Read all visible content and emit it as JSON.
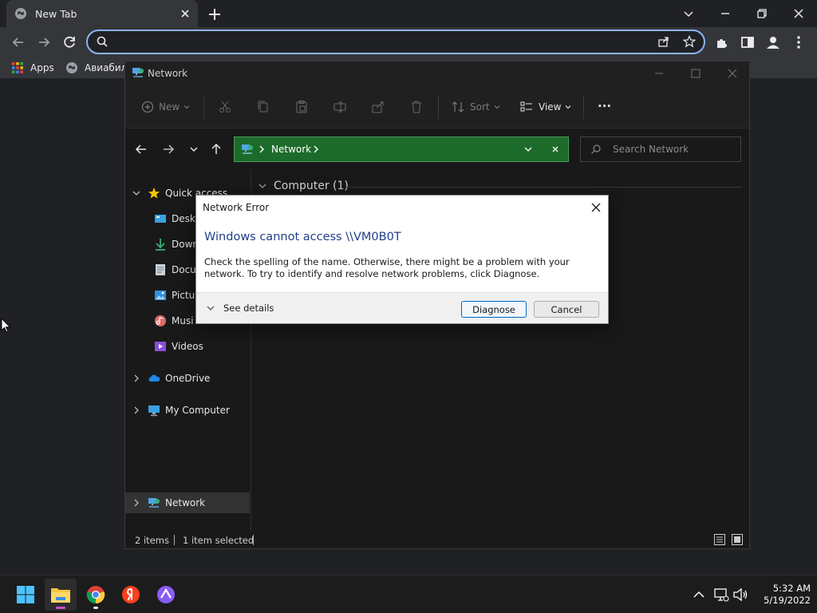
{
  "browser": {
    "tab_title": "New Tab",
    "omnibox_placeholder": "",
    "bookmarks": [
      {
        "label": "Apps",
        "icon": "apps-grid-icon"
      },
      {
        "label": "Авиабиле",
        "icon": "globe-icon"
      }
    ]
  },
  "explorer": {
    "window_title": "Network",
    "commands": {
      "new": "New",
      "sort": "Sort",
      "view": "View",
      "more": "..."
    },
    "address_crumb": "Network",
    "search_placeholder": "Search Network",
    "nav": {
      "quick_access": "Quick access",
      "desktop": "Deskt",
      "downloads": "Down",
      "documents": "Docu",
      "pictures": "Pictur",
      "music": "Musi",
      "videos": "Videos",
      "onedrive": "OneDrive",
      "my_computer": "My Computer",
      "network": "Network"
    },
    "group_header": "Computer (1)",
    "status": {
      "items": "2 items",
      "selected": "1 item selected"
    }
  },
  "dialog": {
    "title": "Network Error",
    "main_instruction": "Windows cannot access \\\\VM0B0T",
    "body": "Check the spelling of the name. Otherwise, there might be a problem with your network. To try to identify and resolve network problems, click Diagnose.",
    "see_details": "See details",
    "diagnose": "Diagnose",
    "cancel": "Cancel"
  },
  "taskbar": {
    "time": "5:32 AM",
    "date": "5/19/2022"
  },
  "colors": {
    "address_bar_bg": "#1d6b2b",
    "dialog_heading": "#1f3f8a",
    "focus_ring": "#8ab4f8",
    "accent_blue": "#0067c0"
  }
}
